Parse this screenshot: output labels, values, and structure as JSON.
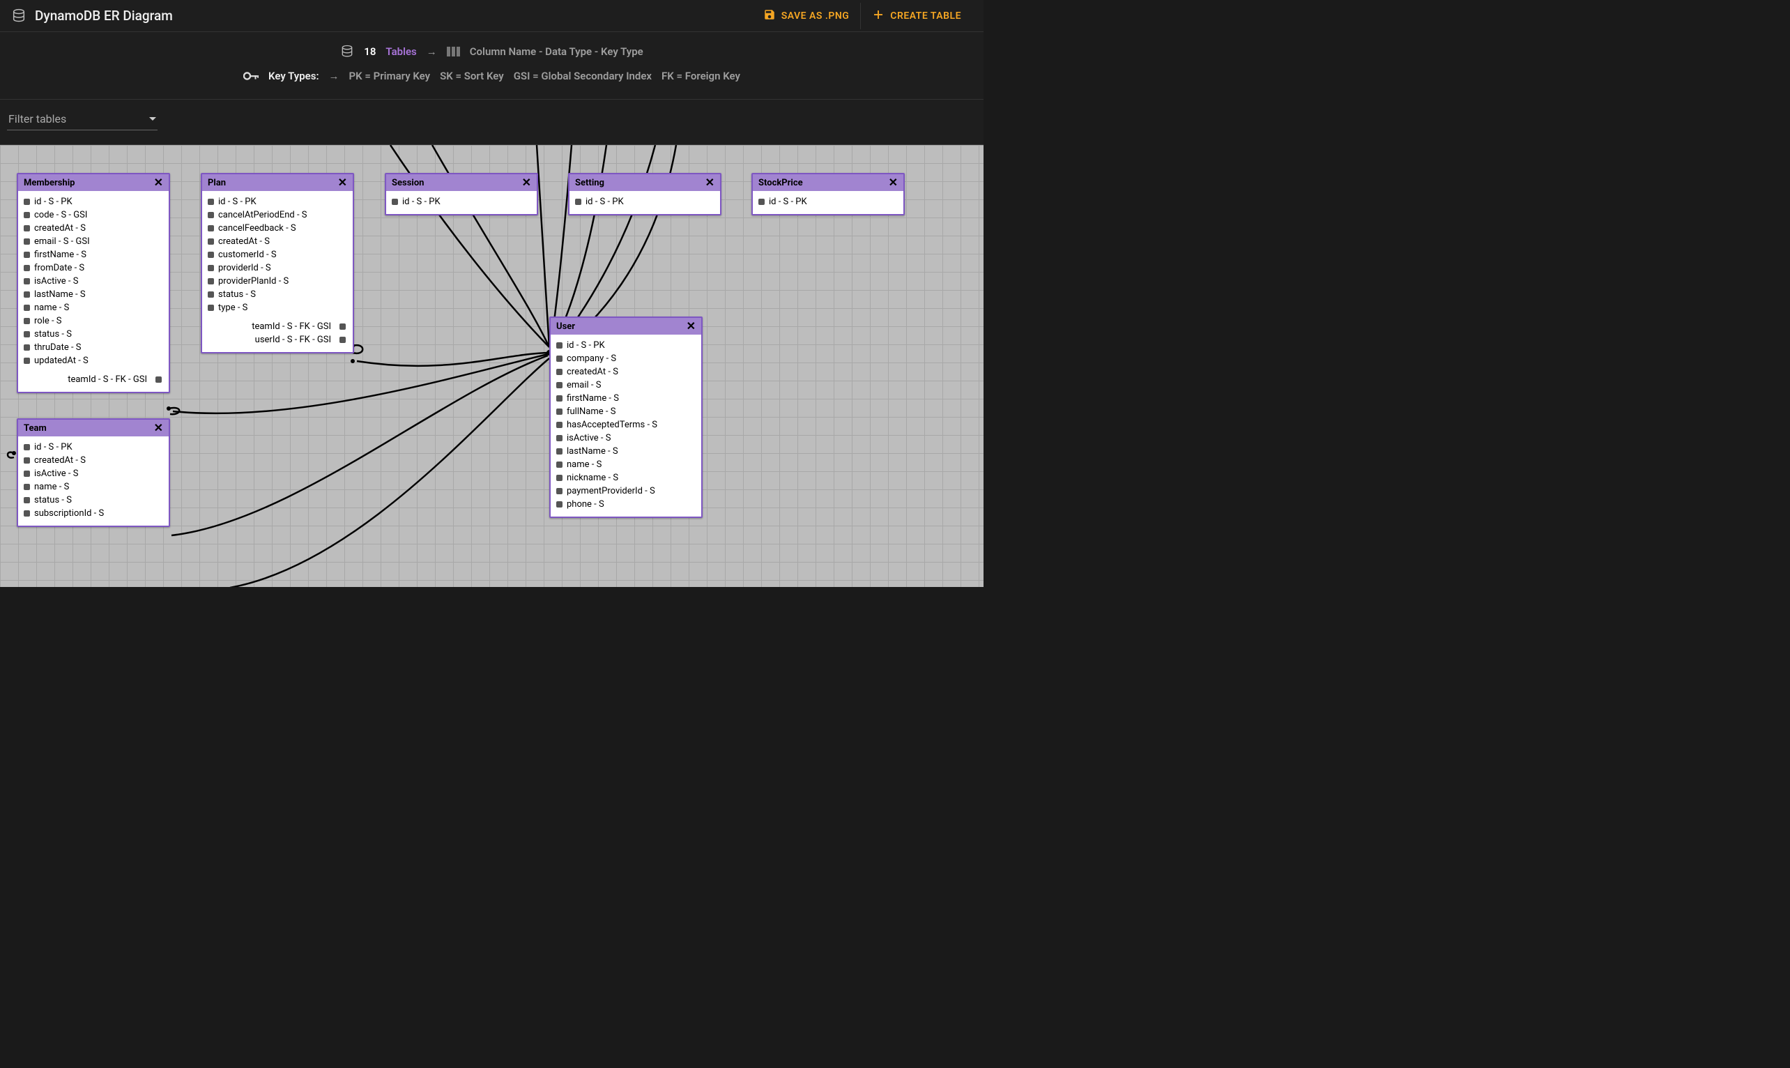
{
  "header": {
    "title": "DynamoDB ER Diagram",
    "save_label": "SAVE AS .PNG",
    "create_label": "CREATE TABLE"
  },
  "legend": {
    "table_count": "18",
    "tables_label": "Tables",
    "column_format": "Column Name - Data Type - Key Type",
    "key_types_label": "Key Types:",
    "pk": "PK = Primary Key",
    "sk": "SK = Sort Key",
    "gsi": "GSI = Global Secondary Index",
    "fk": "FK = Foreign Key"
  },
  "filter_placeholder": "Filter tables",
  "tables": {
    "membership": {
      "name": "Membership",
      "cols": [
        "id - S - PK",
        "code - S - GSI",
        "createdAt - S",
        "email - S - GSI",
        "firstName - S",
        "fromDate - S",
        "isActive - S",
        "lastName - S",
        "name - S",
        "role - S",
        "status - S",
        "thruDate - S",
        "updatedAt - S"
      ],
      "right": [
        "teamId - S - FK - GSI"
      ]
    },
    "plan": {
      "name": "Plan",
      "cols": [
        "id - S - PK",
        "cancelAtPeriodEnd - S",
        "cancelFeedback - S",
        "createdAt - S",
        "customerId - S",
        "providerId - S",
        "providerPlanId - S",
        "status - S",
        "type - S"
      ],
      "right": [
        "teamId - S - FK - GSI",
        "userId - S - FK - GSI"
      ]
    },
    "session": {
      "name": "Session",
      "cols": [
        "id - S - PK"
      ],
      "right": []
    },
    "setting": {
      "name": "Setting",
      "cols": [
        "id - S - PK"
      ],
      "right": []
    },
    "stockprice": {
      "name": "StockPrice",
      "cols": [
        "id - S - PK"
      ],
      "right": []
    },
    "user": {
      "name": "User",
      "cols": [
        "id - S - PK",
        "company - S",
        "createdAt - S",
        "email - S",
        "firstName - S",
        "fullName - S",
        "hasAcceptedTerms - S",
        "isActive - S",
        "lastName - S",
        "name - S",
        "nickname - S",
        "paymentProviderId - S",
        "phone - S"
      ],
      "right": []
    },
    "team": {
      "name": "Team",
      "cols": [
        "id - S - PK",
        "createdAt - S",
        "isActive - S",
        "name - S",
        "status - S",
        "subscriptionId - S"
      ],
      "right": []
    }
  }
}
